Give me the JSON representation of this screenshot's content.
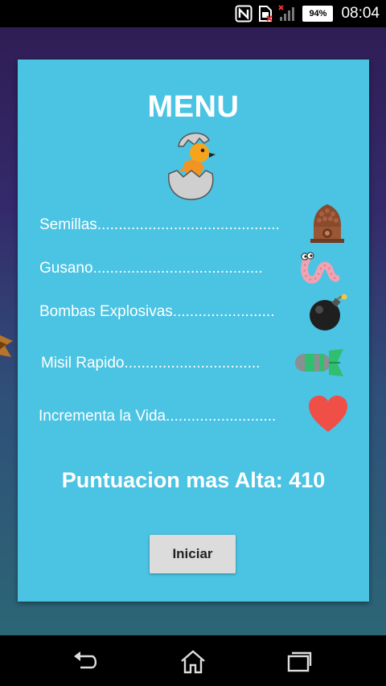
{
  "status_bar": {
    "battery_percent": "94%",
    "time": "08:04",
    "icons": [
      "nfc-icon",
      "sim-missing-icon",
      "signal-icon",
      "battery-icon"
    ]
  },
  "menu": {
    "title": "MENU",
    "items": [
      {
        "label": "Semillas...........................................",
        "icon": "seed-house-icon"
      },
      {
        "label": "Gusano........................................",
        "icon": "worm-icon"
      },
      {
        "label": "Bombas Explosivas........................",
        "icon": "bomb-icon"
      },
      {
        "label": "Misil Rapido................................",
        "icon": "missile-icon"
      },
      {
        "label": "Incrementa la Vida..........................",
        "icon": "heart-icon"
      }
    ],
    "high_score_label": "Puntuacion mas Alta: 410",
    "start_button": "Iniciar"
  },
  "colors": {
    "panel": "#4bc3e3",
    "heart": "#ef4f46",
    "missile_green": "#2fbf6f"
  },
  "nav_bar": {
    "icons": [
      "back-icon",
      "home-icon",
      "recents-icon"
    ]
  }
}
